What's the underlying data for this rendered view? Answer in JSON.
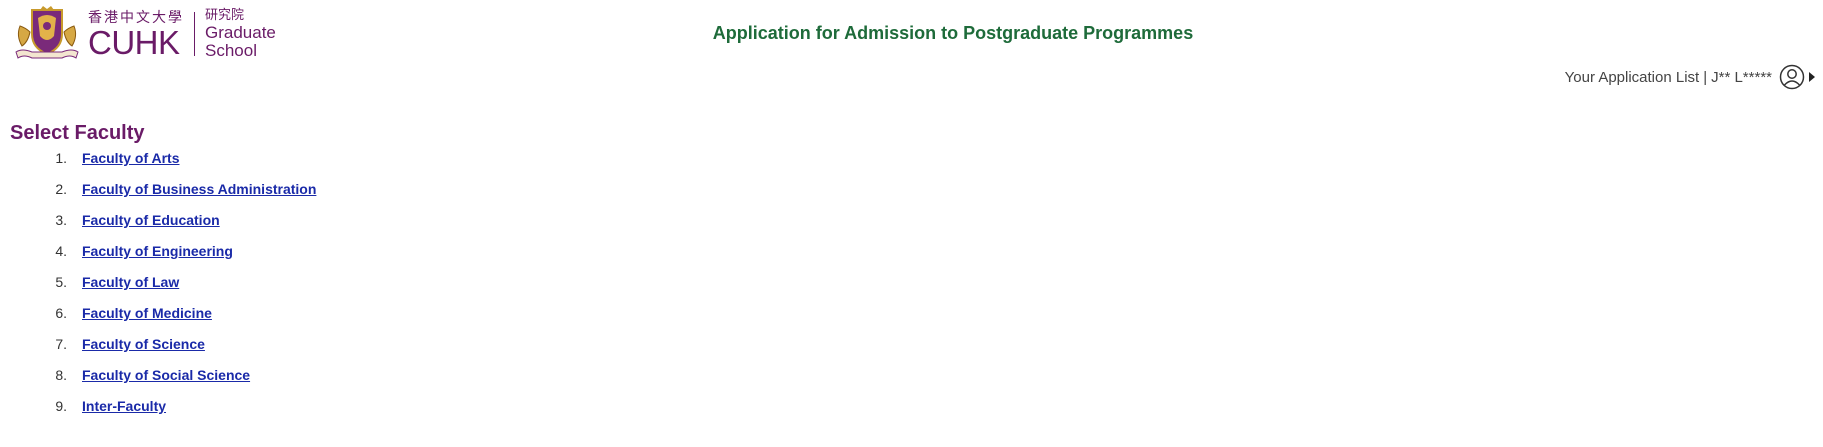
{
  "header": {
    "logo_chinese": "香港中文大學",
    "logo_cuhk": "CUHK",
    "school_chinese": "研究院",
    "school_line1": "Graduate",
    "school_line2": "School",
    "title": "Application for Admission to Postgraduate Programmes"
  },
  "user_bar": {
    "link_label": "Your Application List",
    "separator": "|",
    "user_name": "J** L*****"
  },
  "main": {
    "heading": "Select Faculty",
    "faculties": [
      {
        "num": "1.",
        "label": "Faculty of Arts"
      },
      {
        "num": "2.",
        "label": "Faculty of Business Administration"
      },
      {
        "num": "3.",
        "label": "Faculty of Education"
      },
      {
        "num": "4.",
        "label": "Faculty of Engineering"
      },
      {
        "num": "5.",
        "label": "Faculty of Law"
      },
      {
        "num": "6.",
        "label": "Faculty of Medicine"
      },
      {
        "num": "7.",
        "label": "Faculty of Science"
      },
      {
        "num": "8.",
        "label": "Faculty of Social Science"
      },
      {
        "num": "9.",
        "label": "Inter-Faculty"
      }
    ]
  },
  "colors": {
    "brand_purple": "#6a1b67",
    "title_green": "#1e6b3a",
    "link_blue": "#1a2aa8"
  },
  "icons": {
    "crest": "cuhk-crest-icon",
    "user": "user-circle-icon",
    "dropdown": "caret-right-icon"
  }
}
